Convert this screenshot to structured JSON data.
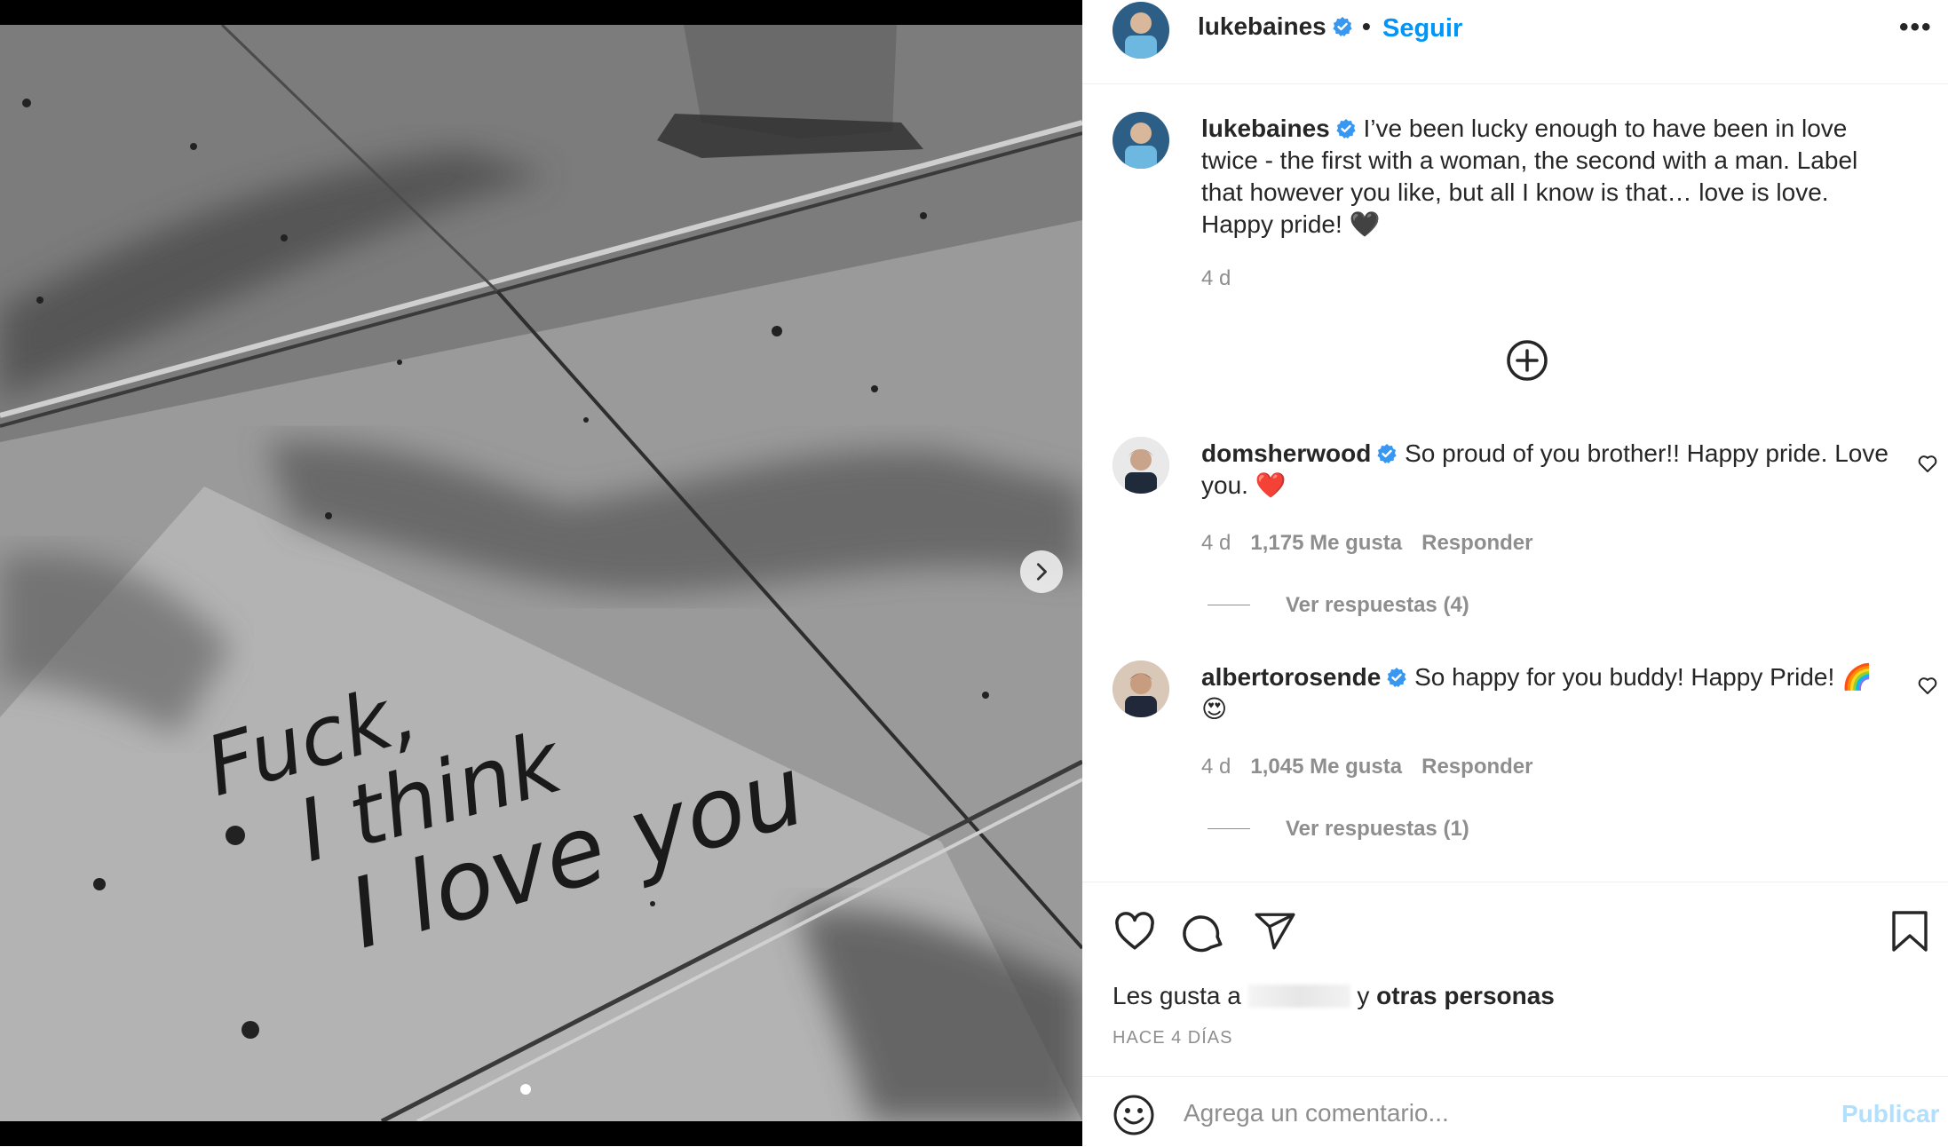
{
  "post": {
    "author": "lukebaines",
    "follow_label": "Seguir",
    "separator": "•",
    "more": "•••",
    "caption": "I’ve been lucky enough to have been in love twice - the first with a woman, the second with a man. Label that however you like, but all I know is that… love is love. Happy pride! 🖤",
    "caption_time": "4 d"
  },
  "photo": {
    "handwriting": [
      "Fuck,",
      "I think",
      "I love you"
    ]
  },
  "comments": [
    {
      "user": "domsherwood",
      "text": "So proud of you brother!! Happy pride. Love you. ❤️",
      "time": "4 d",
      "likes": "1,175 Me gusta",
      "reply": "Responder",
      "view_replies": "Ver respuestas (4)"
    },
    {
      "user": "albertorosende",
      "text": "So happy for you buddy! Happy Pride! 🌈 😍",
      "time": "4 d",
      "likes": "1,045 Me gusta",
      "reply": "Responder",
      "view_replies": "Ver respuestas (1)"
    }
  ],
  "likes_line": {
    "prefix": "Les gusta a",
    "suffix": "y",
    "others": "otras personas"
  },
  "posted": "HACE 4 DÍAS",
  "composer": {
    "placeholder": "Agrega un comentario...",
    "publish": "Publicar"
  },
  "colors": {
    "link_blue": "#0095f6",
    "verified_blue": "#3897f0",
    "muted": "#8e8e8e"
  },
  "icons": [
    "verified-badge-icon",
    "chevron-right-icon",
    "add-circle-icon",
    "heart-icon",
    "comment-icon",
    "share-icon",
    "bookmark-icon",
    "emoji-icon"
  ]
}
